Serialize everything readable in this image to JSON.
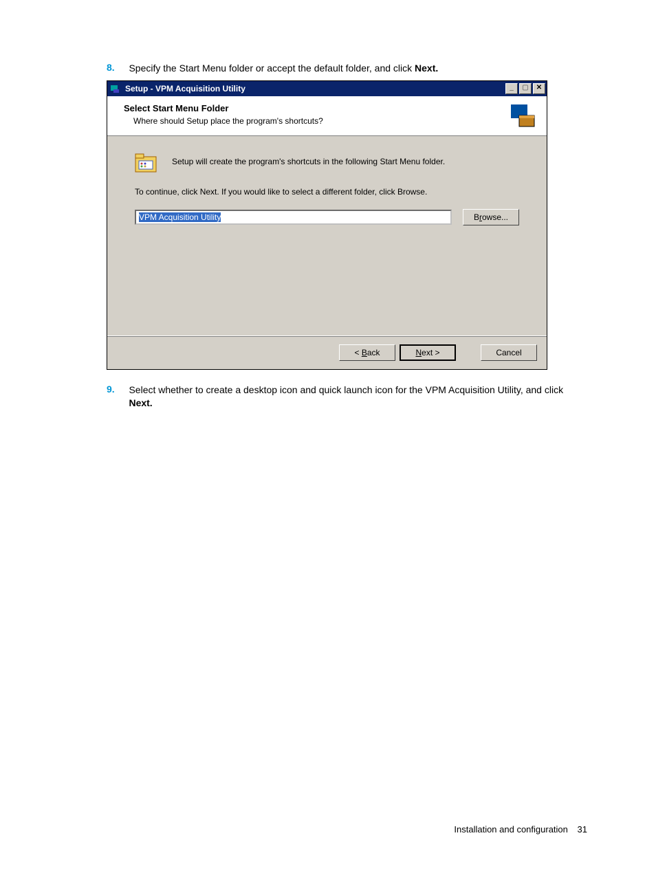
{
  "steps": {
    "n8": "8.",
    "t8a": "Specify the Start Menu folder or accept the default folder, and click ",
    "t8b": "Next.",
    "n9": "9.",
    "t9a": "Select whether to create a desktop icon and quick launch icon for the VPM Acquisition Utility, and click ",
    "t9b": "Next."
  },
  "dialog": {
    "title": "Setup - VPM Acquisition Utility",
    "min_label": "_",
    "max_label": "▢",
    "close_label": "✕",
    "header_title": "Select Start Menu Folder",
    "header_sub": "Where should Setup place the program's shortcuts?",
    "info_text": "Setup will create the program's shortcuts in the following Start Menu folder.",
    "continue_text": "To continue, click Next. If you would like to select a different folder, click Browse.",
    "path_value": "VPM Acquisition Utility",
    "browse_label_pre": "B",
    "browse_label_u": "r",
    "browse_label_post": "owse...",
    "back_label_pre": "< ",
    "back_label_u": "B",
    "back_label_post": "ack",
    "next_label_u": "N",
    "next_label_post": "ext >",
    "cancel_label": "Cancel"
  },
  "footer": {
    "section": "Installation and configuration",
    "page": "31"
  }
}
